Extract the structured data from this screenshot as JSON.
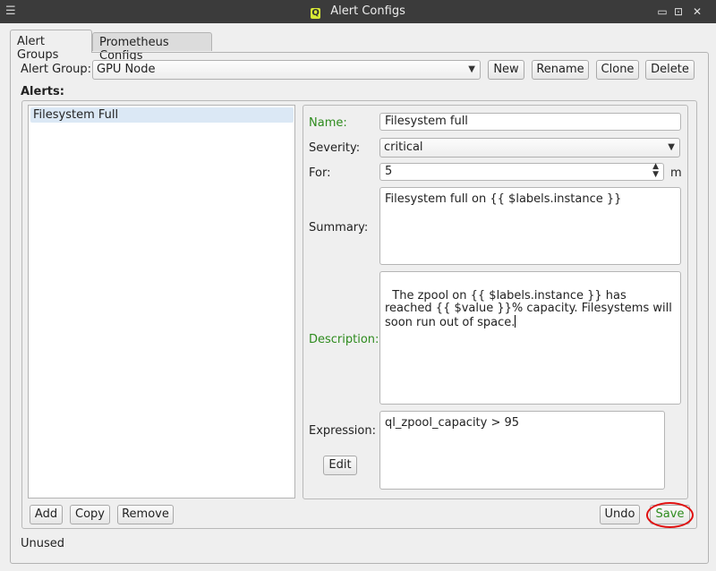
{
  "window": {
    "title": "Alert Configs",
    "menu_icon": "☰",
    "app_icon_letter": "Q",
    "minimize_glyph": "▭",
    "maximize_glyph": "⊡",
    "close_glyph": "✕"
  },
  "tabs": [
    {
      "label": "Alert Groups",
      "active": true
    },
    {
      "label": "Prometheus Configs",
      "active": false
    }
  ],
  "alert_group": {
    "label": "Alert Group:",
    "selected": "GPU Node",
    "buttons": {
      "new": "New",
      "rename": "Rename",
      "clone": "Clone",
      "delete": "Delete"
    }
  },
  "alerts": {
    "section_label": "Alerts:",
    "items": [
      "Filesystem Full"
    ],
    "buttons": {
      "add": "Add",
      "copy": "Copy",
      "remove": "Remove"
    }
  },
  "detail": {
    "name_label": "Name:",
    "name_value": "Filesystem full",
    "severity_label": "Severity:",
    "severity_value": "critical",
    "for_label": "For:",
    "for_value": "5",
    "for_unit": "m",
    "summary_label": "Summary:",
    "summary_value": "Filesystem full on {{ $labels.instance }}",
    "description_label": "Description:",
    "description_value": "The zpool on {{ $labels.instance }} has reached {{ $value }}% capacity. Filesystems will soon run out of space.",
    "expression_label": "Expression:",
    "expression_value": "ql_zpool_capacity > 95",
    "edit_button": "Edit"
  },
  "footer": {
    "undo": "Undo",
    "save": "Save",
    "status": "Unused"
  },
  "colors": {
    "modified_label": "#2e8b1e",
    "save_highlight": "#e01010",
    "selection": "#dbe8f5",
    "titlebar": "#3b3b3b"
  }
}
